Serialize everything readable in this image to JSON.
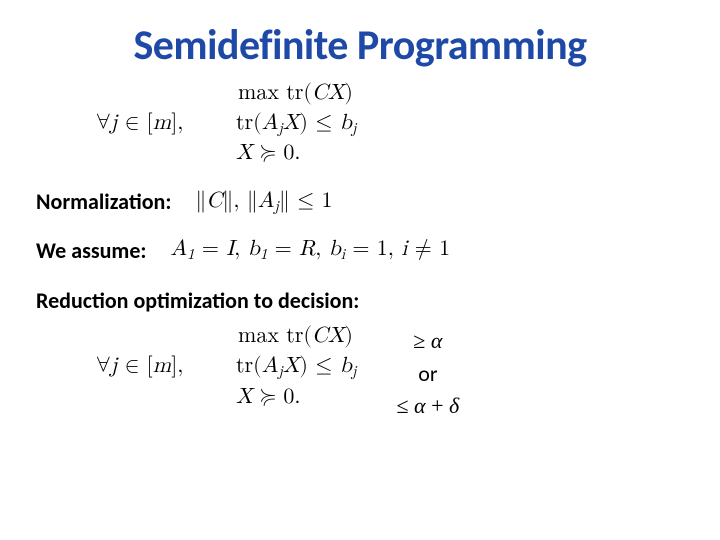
{
  "title": "Semidefinite Programming",
  "sdp": {
    "objective": "max tr(CX)",
    "forall": "∀j ∈ [m],",
    "constraint": "tr(AⱼX) ≤ bⱼ",
    "psd": "X ≽ 0."
  },
  "normalization": {
    "label": "Normalization:",
    "expr": "∥C∥, ∥Aⱼ∥ ≤ 1"
  },
  "assume": {
    "label": "We assume:",
    "expr": "A₁ = I, b₁ = R, bᵢ = 1, i ≠ 1"
  },
  "reduction": {
    "label": "Reduction optimization to decision:",
    "alpha_upper": "≥ α",
    "or": "or",
    "alpha_lower": "≤ α + δ"
  }
}
